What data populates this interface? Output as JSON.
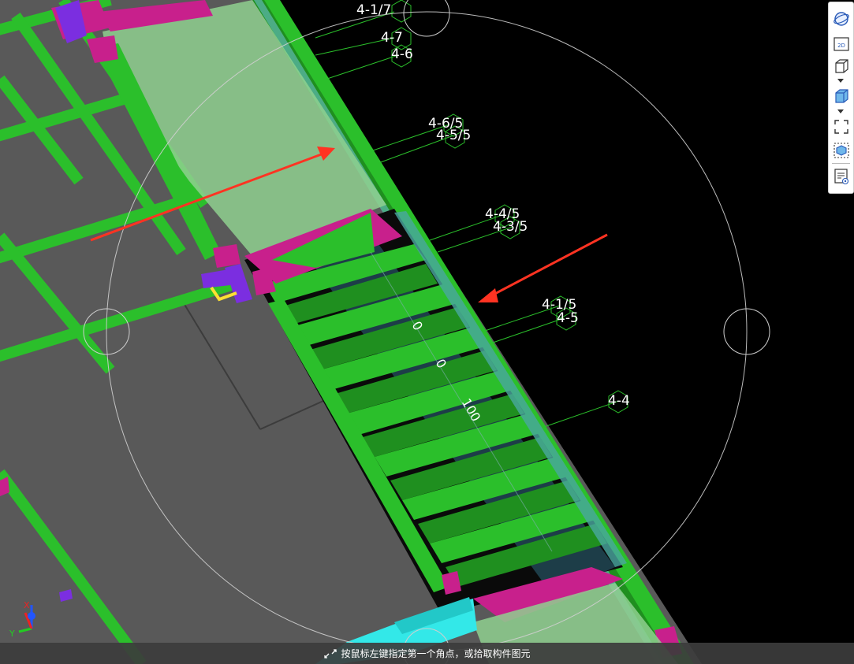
{
  "viewport": {
    "grid_axes": [
      {
        "id": "axis-4-1-7",
        "label": "4-1/7"
      },
      {
        "id": "axis-4-7",
        "label": "4-7"
      },
      {
        "id": "axis-4-6",
        "label": "4-6"
      },
      {
        "id": "axis-4-6-5",
        "label": "4-6/5"
      },
      {
        "id": "axis-4-5-5",
        "label": "4-5/5"
      },
      {
        "id": "axis-4-4-5",
        "label": "4-4/5"
      },
      {
        "id": "axis-4-3-5",
        "label": "4-3/5"
      },
      {
        "id": "axis-4-1-5",
        "label": "4-1/5"
      },
      {
        "id": "axis-4-5",
        "label": "4-5"
      },
      {
        "id": "axis-4-4",
        "label": "4-4"
      }
    ],
    "dimension_labels": [
      "0",
      "0",
      "100"
    ],
    "colors": {
      "background": "#000000",
      "slab": "#595959",
      "beam": "#2bbf2b",
      "beam_dark": "#1f8f1f",
      "column": "#c8208c",
      "column_purple": "#7b2ee0",
      "translucent_slab": "#8fd08f",
      "cyan_element": "#33e8e8",
      "annotation_arrow": "#ff3322",
      "selection_marker": "#ffe033",
      "orbit_circle": "#cfcfcf"
    }
  },
  "axis_gizmo": {
    "x_label": "X",
    "y_label": "Y"
  },
  "toolbar": {
    "buttons": [
      {
        "name": "orbit-view-icon"
      },
      {
        "name": "2d-view-icon",
        "text": "2D"
      },
      {
        "name": "3d-box-view-icon"
      },
      {
        "name": "3d-shaded-view-icon"
      },
      {
        "name": "fit-view-icon"
      },
      {
        "name": "isolate-component-icon"
      },
      {
        "name": "display-settings-icon"
      }
    ]
  },
  "status": {
    "prompt": "按鼠标左键指定第一个角点，或拾取构件图元"
  }
}
